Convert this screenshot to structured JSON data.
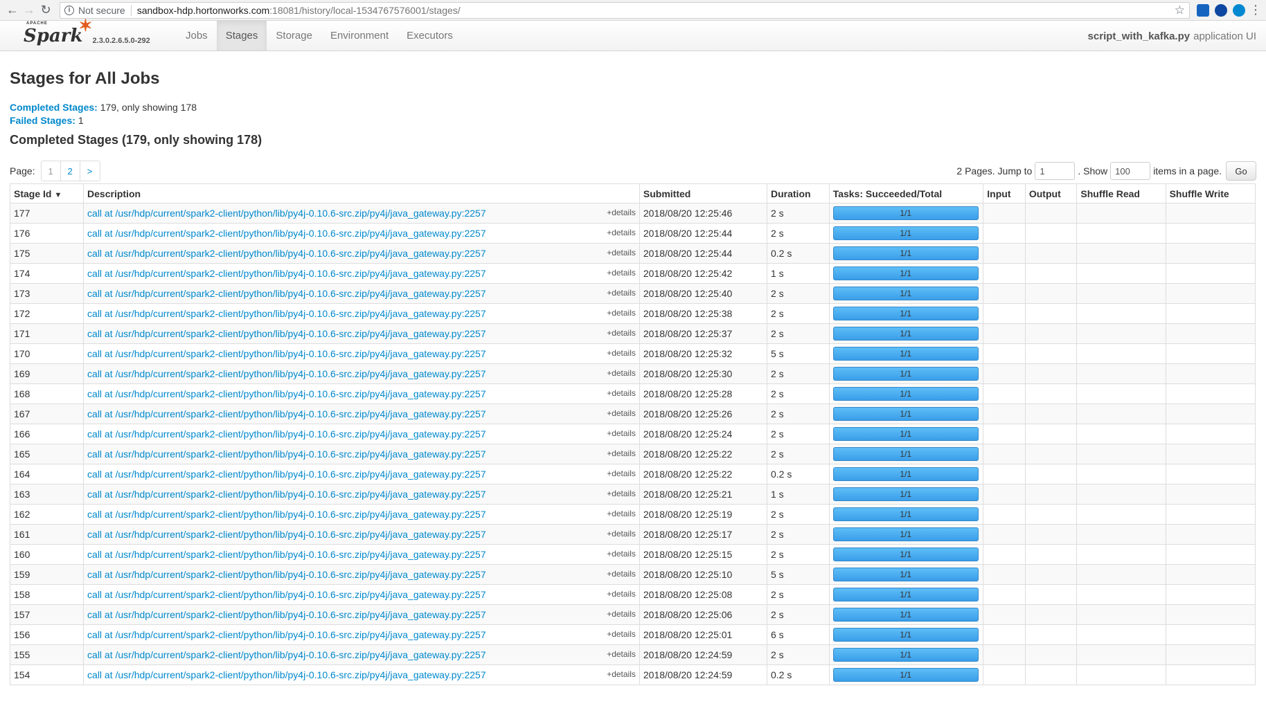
{
  "browser": {
    "security_label": "Not secure",
    "url_host": "sandbox-hdp.hortonworks.com",
    "url_rest": ":18081/history/local-1534767576001/stages/"
  },
  "navbar": {
    "apache": "APACHE",
    "logo": "Spark",
    "version": "2.3.0.2.6.5.0-292",
    "tabs": [
      "Jobs",
      "Stages",
      "Storage",
      "Environment",
      "Executors"
    ],
    "active_tab": "Stages",
    "app_name": "script_with_kafka.py",
    "app_suffix": "application UI"
  },
  "page": {
    "title": "Stages for All Jobs",
    "completed_key": "Completed Stages:",
    "completed_value": "179, only showing 178",
    "failed_key": "Failed Stages:",
    "failed_value": "1",
    "section_title": "Completed Stages (179, only showing 178)"
  },
  "pagination": {
    "label": "Page:",
    "pages": [
      "1",
      "2",
      ">"
    ],
    "jump_prefix": "2 Pages. Jump to",
    "jump_value": "1",
    "show_prefix": ". Show",
    "show_value": "100",
    "show_suffix": "items in a page.",
    "go_label": "Go"
  },
  "table": {
    "columns": [
      "Stage Id",
      "Description",
      "Submitted",
      "Duration",
      "Tasks: Succeeded/Total",
      "Input",
      "Output",
      "Shuffle Read",
      "Shuffle Write"
    ],
    "sort_indicator": "▼",
    "details_label": "+details",
    "rows": [
      {
        "id": "177",
        "desc": "call at /usr/hdp/current/spark2-client/python/lib/py4j-0.10.6-src.zip/py4j/java_gateway.py:2257",
        "submitted": "2018/08/20 12:25:46",
        "duration": "2 s",
        "tasks": "1/1",
        "progress_fraction": 1.0
      },
      {
        "id": "176",
        "desc": "call at /usr/hdp/current/spark2-client/python/lib/py4j-0.10.6-src.zip/py4j/java_gateway.py:2257",
        "submitted": "2018/08/20 12:25:44",
        "duration": "2 s",
        "tasks": "1/1",
        "progress_fraction": 1.0
      },
      {
        "id": "175",
        "desc": "call at /usr/hdp/current/spark2-client/python/lib/py4j-0.10.6-src.zip/py4j/java_gateway.py:2257",
        "submitted": "2018/08/20 12:25:44",
        "duration": "0.2 s",
        "tasks": "1/1",
        "progress_fraction": 1.0
      },
      {
        "id": "174",
        "desc": "call at /usr/hdp/current/spark2-client/python/lib/py4j-0.10.6-src.zip/py4j/java_gateway.py:2257",
        "submitted": "2018/08/20 12:25:42",
        "duration": "1 s",
        "tasks": "1/1",
        "progress_fraction": 1.0
      },
      {
        "id": "173",
        "desc": "call at /usr/hdp/current/spark2-client/python/lib/py4j-0.10.6-src.zip/py4j/java_gateway.py:2257",
        "submitted": "2018/08/20 12:25:40",
        "duration": "2 s",
        "tasks": "1/1",
        "progress_fraction": 1.0
      },
      {
        "id": "172",
        "desc": "call at /usr/hdp/current/spark2-client/python/lib/py4j-0.10.6-src.zip/py4j/java_gateway.py:2257",
        "submitted": "2018/08/20 12:25:38",
        "duration": "2 s",
        "tasks": "1/1",
        "progress_fraction": 1.0
      },
      {
        "id": "171",
        "desc": "call at /usr/hdp/current/spark2-client/python/lib/py4j-0.10.6-src.zip/py4j/java_gateway.py:2257",
        "submitted": "2018/08/20 12:25:37",
        "duration": "2 s",
        "tasks": "1/1",
        "progress_fraction": 1.0
      },
      {
        "id": "170",
        "desc": "call at /usr/hdp/current/spark2-client/python/lib/py4j-0.10.6-src.zip/py4j/java_gateway.py:2257",
        "submitted": "2018/08/20 12:25:32",
        "duration": "5 s",
        "tasks": "1/1",
        "progress_fraction": 1.0
      },
      {
        "id": "169",
        "desc": "call at /usr/hdp/current/spark2-client/python/lib/py4j-0.10.6-src.zip/py4j/java_gateway.py:2257",
        "submitted": "2018/08/20 12:25:30",
        "duration": "2 s",
        "tasks": "1/1",
        "progress_fraction": 1.0
      },
      {
        "id": "168",
        "desc": "call at /usr/hdp/current/spark2-client/python/lib/py4j-0.10.6-src.zip/py4j/java_gateway.py:2257",
        "submitted": "2018/08/20 12:25:28",
        "duration": "2 s",
        "tasks": "1/1",
        "progress_fraction": 1.0
      },
      {
        "id": "167",
        "desc": "call at /usr/hdp/current/spark2-client/python/lib/py4j-0.10.6-src.zip/py4j/java_gateway.py:2257",
        "submitted": "2018/08/20 12:25:26",
        "duration": "2 s",
        "tasks": "1/1",
        "progress_fraction": 1.0
      },
      {
        "id": "166",
        "desc": "call at /usr/hdp/current/spark2-client/python/lib/py4j-0.10.6-src.zip/py4j/java_gateway.py:2257",
        "submitted": "2018/08/20 12:25:24",
        "duration": "2 s",
        "tasks": "1/1",
        "progress_fraction": 1.0
      },
      {
        "id": "165",
        "desc": "call at /usr/hdp/current/spark2-client/python/lib/py4j-0.10.6-src.zip/py4j/java_gateway.py:2257",
        "submitted": "2018/08/20 12:25:22",
        "duration": "2 s",
        "tasks": "1/1",
        "progress_fraction": 1.0
      },
      {
        "id": "164",
        "desc": "call at /usr/hdp/current/spark2-client/python/lib/py4j-0.10.6-src.zip/py4j/java_gateway.py:2257",
        "submitted": "2018/08/20 12:25:22",
        "duration": "0.2 s",
        "tasks": "1/1",
        "progress_fraction": 1.0
      },
      {
        "id": "163",
        "desc": "call at /usr/hdp/current/spark2-client/python/lib/py4j-0.10.6-src.zip/py4j/java_gateway.py:2257",
        "submitted": "2018/08/20 12:25:21",
        "duration": "1 s",
        "tasks": "1/1",
        "progress_fraction": 1.0
      },
      {
        "id": "162",
        "desc": "call at /usr/hdp/current/spark2-client/python/lib/py4j-0.10.6-src.zip/py4j/java_gateway.py:2257",
        "submitted": "2018/08/20 12:25:19",
        "duration": "2 s",
        "tasks": "1/1",
        "progress_fraction": 1.0
      },
      {
        "id": "161",
        "desc": "call at /usr/hdp/current/spark2-client/python/lib/py4j-0.10.6-src.zip/py4j/java_gateway.py:2257",
        "submitted": "2018/08/20 12:25:17",
        "duration": "2 s",
        "tasks": "1/1",
        "progress_fraction": 1.0
      },
      {
        "id": "160",
        "desc": "call at /usr/hdp/current/spark2-client/python/lib/py4j-0.10.6-src.zip/py4j/java_gateway.py:2257",
        "submitted": "2018/08/20 12:25:15",
        "duration": "2 s",
        "tasks": "1/1",
        "progress_fraction": 1.0
      },
      {
        "id": "159",
        "desc": "call at /usr/hdp/current/spark2-client/python/lib/py4j-0.10.6-src.zip/py4j/java_gateway.py:2257",
        "submitted": "2018/08/20 12:25:10",
        "duration": "5 s",
        "tasks": "1/1",
        "progress_fraction": 1.0
      },
      {
        "id": "158",
        "desc": "call at /usr/hdp/current/spark2-client/python/lib/py4j-0.10.6-src.zip/py4j/java_gateway.py:2257",
        "submitted": "2018/08/20 12:25:08",
        "duration": "2 s",
        "tasks": "1/1",
        "progress_fraction": 1.0
      },
      {
        "id": "157",
        "desc": "call at /usr/hdp/current/spark2-client/python/lib/py4j-0.10.6-src.zip/py4j/java_gateway.py:2257",
        "submitted": "2018/08/20 12:25:06",
        "duration": "2 s",
        "tasks": "1/1",
        "progress_fraction": 1.0
      },
      {
        "id": "156",
        "desc": "call at /usr/hdp/current/spark2-client/python/lib/py4j-0.10.6-src.zip/py4j/java_gateway.py:2257",
        "submitted": "2018/08/20 12:25:01",
        "duration": "6 s",
        "tasks": "1/1",
        "progress_fraction": 1.0
      },
      {
        "id": "155",
        "desc": "call at /usr/hdp/current/spark2-client/python/lib/py4j-0.10.6-src.zip/py4j/java_gateway.py:2257",
        "submitted": "2018/08/20 12:24:59",
        "duration": "2 s",
        "tasks": "1/1",
        "progress_fraction": 1.0
      },
      {
        "id": "154",
        "desc": "call at /usr/hdp/current/spark2-client/python/lib/py4j-0.10.6-src.zip/py4j/java_gateway.py:2257",
        "submitted": "2018/08/20 12:24:59",
        "duration": "0.2 s",
        "tasks": "1/1",
        "progress_fraction": 1.0
      }
    ]
  },
  "colors": {
    "link": "#0088cc",
    "progress_bar": "#3a9ee9",
    "spark_star": "#e25a1c"
  }
}
